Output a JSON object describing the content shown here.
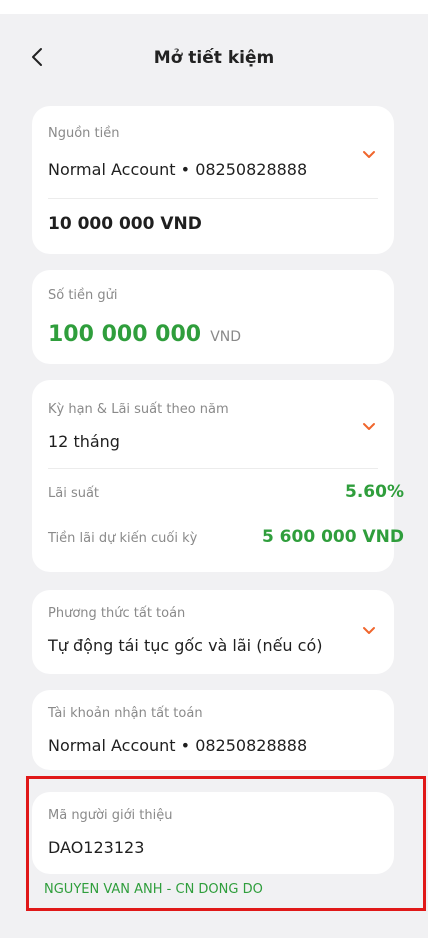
{
  "header": {
    "back_glyph": "<",
    "title": "Mở tiết kiệm"
  },
  "source": {
    "label": "Nguồn tiền",
    "account": "Normal Account • 08250828888",
    "balance": "10 000 000 VND"
  },
  "deposit": {
    "label": "Số tiền gửi",
    "amount": "100 000 000",
    "currency": "VND"
  },
  "term": {
    "label": "Kỳ hạn & Lãi suất theo năm",
    "value": "12 tháng",
    "rate_label": "Lãi suất",
    "rate_value": "5.60%",
    "interest_label": "Tiền lãi dự kiến cuối kỳ",
    "interest_value": "5 600 000 VND"
  },
  "settlement": {
    "label": "Phương thức tất toán",
    "value": "Tự động tái tục gốc và lãi (nếu có)"
  },
  "receive_account": {
    "label": "Tài khoản nhận tất toán",
    "value": "Normal Account • 08250828888"
  },
  "referrer": {
    "label": "Mã người giới thiệu",
    "code": "DAO123123",
    "name": "NGUYEN VAN ANH - CN DONG DO"
  },
  "colors": {
    "accent_green": "#2f9e3c",
    "chevron_orange": "#f0662d",
    "highlight_red": "#e01818"
  },
  "icons": [
    "back-arrow-icon",
    "chevron-down-icon"
  ]
}
